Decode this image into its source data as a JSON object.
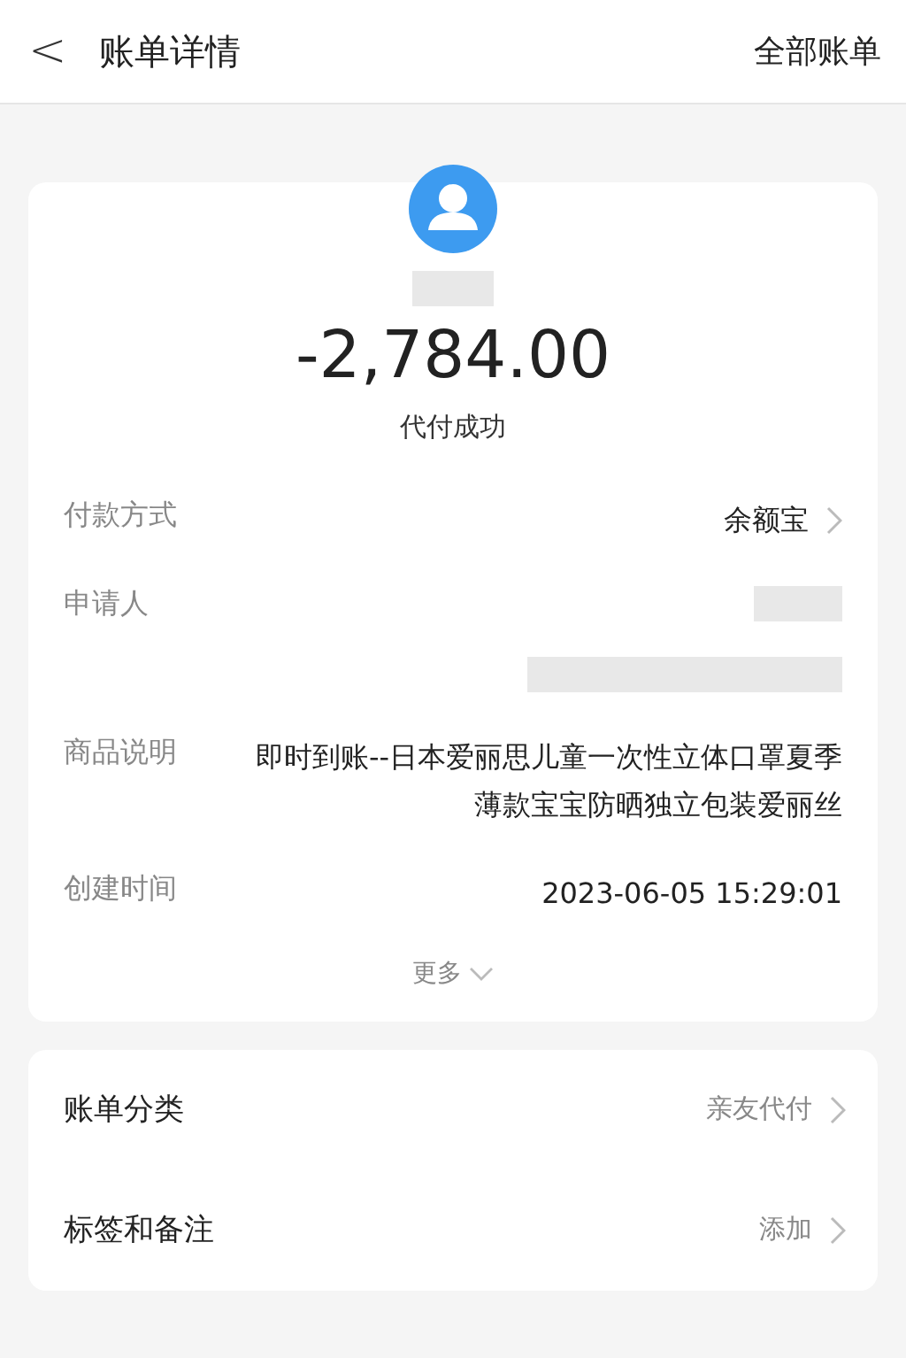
{
  "header": {
    "back_icon": "<",
    "title": "账单详情",
    "action": "全部账单"
  },
  "summary": {
    "amount": "-2,784.00",
    "status": "代付成功"
  },
  "details": [
    {
      "kind": "link",
      "label": "付款方式",
      "value": "余额宝"
    },
    {
      "kind": "redacted",
      "label": "申请人"
    },
    {
      "kind": "text",
      "label": "商品说明",
      "value": "即时到账--日本爱丽思儿童一次性立体口罩夏季薄款宝宝防晒独立包装爱丽丝"
    },
    {
      "kind": "text",
      "label": "创建时间",
      "value": "2023-06-05 15:29:01"
    }
  ],
  "more": "更多",
  "options": [
    {
      "label": "账单分类",
      "value": "亲友代付"
    },
    {
      "label": "标签和备注",
      "value": "添加"
    }
  ]
}
